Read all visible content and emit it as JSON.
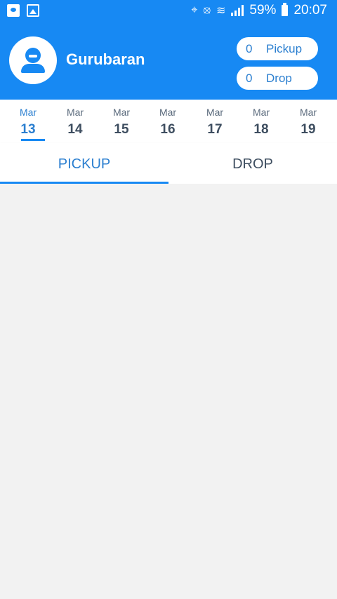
{
  "status_bar": {
    "battery": "59%",
    "time": "20:07",
    "icons": [
      "app-notification-icon",
      "image-notification-icon",
      "location-icon",
      "vibrate-icon",
      "wifi-icon",
      "signal-icon",
      "battery-icon"
    ]
  },
  "header": {
    "username": "Gurubaran",
    "pickup_count": "0",
    "pickup_label": "Pickup",
    "drop_count": "0",
    "drop_label": "Drop"
  },
  "dates": [
    {
      "month": "Mar",
      "day": "13",
      "selected": true
    },
    {
      "month": "Mar",
      "day": "14"
    },
    {
      "month": "Mar",
      "day": "15"
    },
    {
      "month": "Mar",
      "day": "16"
    },
    {
      "month": "Mar",
      "day": "17"
    },
    {
      "month": "Mar",
      "day": "18"
    },
    {
      "month": "Mar",
      "day": "19"
    }
  ],
  "tabs": {
    "pickup": "PICKUP",
    "drop": "DROP",
    "active": "pickup"
  },
  "colors": {
    "primary": "#1789f3",
    "accent_text": "#2b7fd0",
    "background": "#f2f2f2"
  }
}
